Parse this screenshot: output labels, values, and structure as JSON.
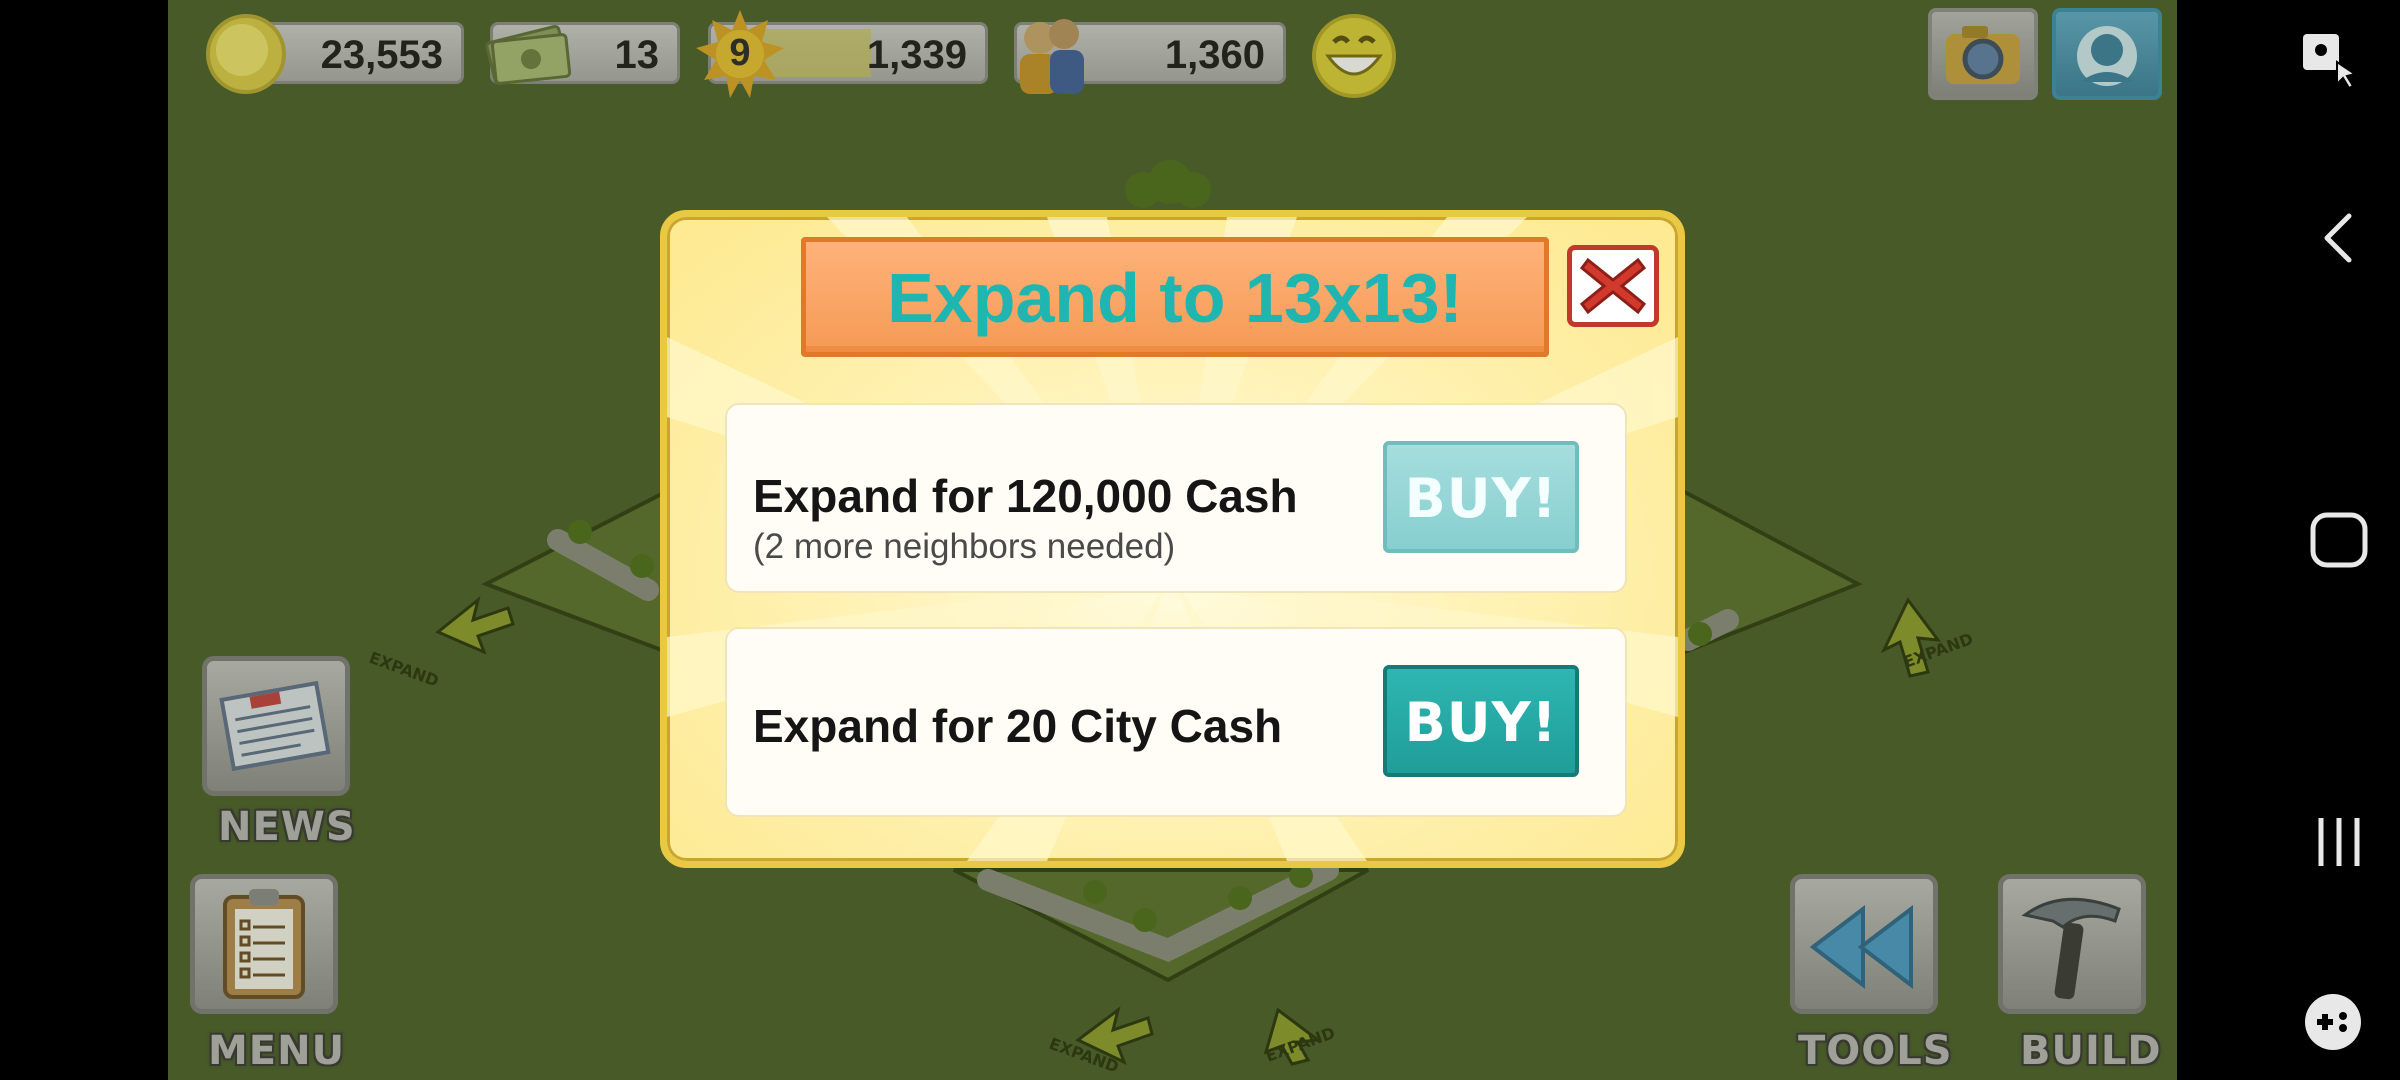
{
  "hud": {
    "coins": "23,553",
    "cash": "13",
    "level": "9",
    "xp": "1,339",
    "population": "1,360"
  },
  "dialog": {
    "title": "Expand to 13x13!",
    "options": [
      {
        "main": "Expand for 120,000 Cash",
        "sub": "(2 more neighbors needed)",
        "buy_label": "BUY!",
        "enabled": false
      },
      {
        "main": "Expand for 20 City Cash",
        "sub": "",
        "buy_label": "BUY!",
        "enabled": true
      }
    ]
  },
  "side_buttons": {
    "news": "NEWS",
    "menu": "MENU",
    "tools": "TOOLS",
    "build": "BUILD"
  },
  "map_labels": {
    "expand": "EXPAND"
  },
  "colors": {
    "ground": "#4a5e2c",
    "title_text": "#1fb5b0",
    "buy_enabled": "#23a8a4",
    "buy_disabled": "#8fd3d4",
    "banner": "#f59a55",
    "dialog_border": "#e9c844"
  },
  "icons": [
    "coin-icon",
    "cash-bills-icon",
    "level-sun-icon",
    "population-people-icon",
    "happiness-smiley-icon",
    "camera-icon",
    "social-icon",
    "newspaper-icon",
    "clipboard-icon",
    "rewind-icon",
    "hammer-icon",
    "close-x-icon"
  ]
}
